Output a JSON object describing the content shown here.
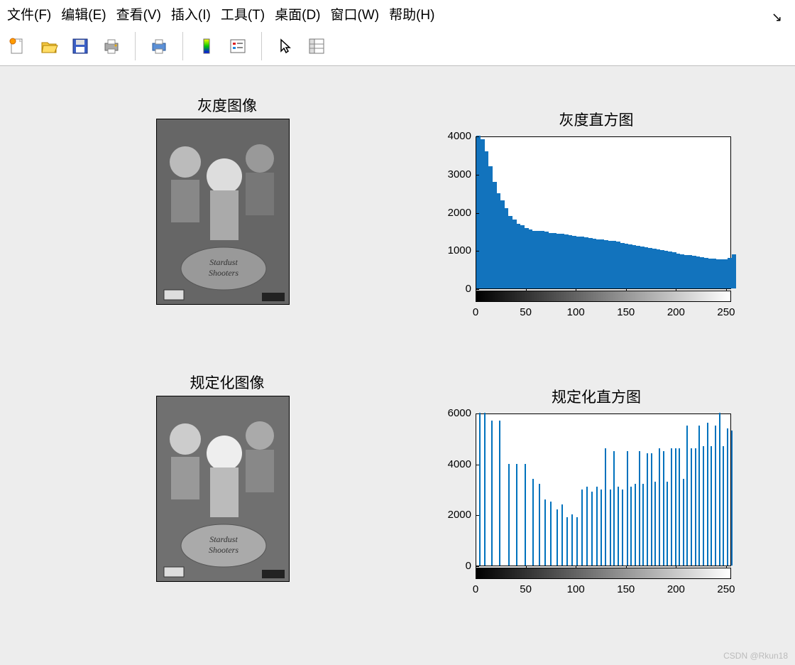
{
  "menu": {
    "items": [
      "文件(F)",
      "编辑(E)",
      "查看(V)",
      "插入(I)",
      "工具(T)",
      "桌面(D)",
      "窗口(W)",
      "帮助(H)"
    ]
  },
  "toolbar": {
    "icons": [
      "new-file-icon",
      "open-file-icon",
      "save-icon",
      "print-icon",
      "print-figure-icon",
      "colorbar-icon",
      "legend-icon",
      "pointer-icon",
      "data-cursor-icon"
    ]
  },
  "titles": {
    "sp1": "灰度图像",
    "sp2": "灰度直方图",
    "sp3": "规定化图像",
    "sp4": "规定化直方图"
  },
  "watermark": "CSDN @Rkun18",
  "chart_data": [
    {
      "type": "bar",
      "title": "灰度直方图",
      "xlabel": "",
      "ylabel": "",
      "xlim": [
        0,
        255
      ],
      "ylim": [
        0,
        4000
      ],
      "xticks": [
        0,
        50,
        100,
        150,
        200,
        250
      ],
      "yticks": [
        0,
        1000,
        2000,
        3000,
        4000
      ],
      "data_note": "256-bin histogram, peak near x=2 at ~4000 decaying to ~700 near x=220 rising to ~1000 at x=255",
      "approx_values_stride4": [
        4000,
        3900,
        3600,
        3200,
        2800,
        2500,
        2300,
        2100,
        1900,
        1800,
        1700,
        1650,
        1580,
        1550,
        1500,
        1500,
        1500,
        1480,
        1460,
        1450,
        1440,
        1430,
        1420,
        1400,
        1380,
        1360,
        1350,
        1340,
        1320,
        1300,
        1290,
        1280,
        1260,
        1250,
        1240,
        1220,
        1200,
        1180,
        1160,
        1140,
        1120,
        1100,
        1080,
        1060,
        1040,
        1020,
        1000,
        980,
        960,
        940,
        920,
        900,
        880,
        870,
        850,
        830,
        820,
        800,
        790,
        780,
        770,
        760,
        770,
        800,
        900
      ]
    },
    {
      "type": "bar",
      "title": "规定化直方图",
      "xlabel": "",
      "ylabel": "",
      "xlim": [
        0,
        255
      ],
      "ylim": [
        0,
        6000
      ],
      "xticks": [
        0,
        50,
        100,
        150,
        200,
        250
      ],
      "yticks": [
        0,
        2000,
        4000,
        6000
      ],
      "data_note": "sparse stems with irregular spacing; heights range 1800-6000; increasing density and height toward right",
      "approx_stems": [
        {
          "x": 3,
          "y": 6000
        },
        {
          "x": 8,
          "y": 6000
        },
        {
          "x": 15,
          "y": 5700
        },
        {
          "x": 23,
          "y": 5700
        },
        {
          "x": 32,
          "y": 4000
        },
        {
          "x": 40,
          "y": 4000
        },
        {
          "x": 48,
          "y": 4000
        },
        {
          "x": 56,
          "y": 3400
        },
        {
          "x": 62,
          "y": 3200
        },
        {
          "x": 68,
          "y": 2600
        },
        {
          "x": 74,
          "y": 2500
        },
        {
          "x": 80,
          "y": 2200
        },
        {
          "x": 85,
          "y": 2400
        },
        {
          "x": 90,
          "y": 1900
        },
        {
          "x": 95,
          "y": 2000
        },
        {
          "x": 100,
          "y": 1900
        },
        {
          "x": 105,
          "y": 3000
        },
        {
          "x": 110,
          "y": 3100
        },
        {
          "x": 115,
          "y": 2900
        },
        {
          "x": 120,
          "y": 3100
        },
        {
          "x": 124,
          "y": 3000
        },
        {
          "x": 128,
          "y": 4600
        },
        {
          "x": 133,
          "y": 3000
        },
        {
          "x": 137,
          "y": 4500
        },
        {
          "x": 141,
          "y": 3100
        },
        {
          "x": 145,
          "y": 3000
        },
        {
          "x": 150,
          "y": 4500
        },
        {
          "x": 154,
          "y": 3100
        },
        {
          "x": 158,
          "y": 3200
        },
        {
          "x": 162,
          "y": 4500
        },
        {
          "x": 166,
          "y": 3200
        },
        {
          "x": 170,
          "y": 4400
        },
        {
          "x": 174,
          "y": 4400
        },
        {
          "x": 178,
          "y": 3300
        },
        {
          "x": 182,
          "y": 4600
        },
        {
          "x": 186,
          "y": 4500
        },
        {
          "x": 190,
          "y": 3300
        },
        {
          "x": 194,
          "y": 4600
        },
        {
          "x": 198,
          "y": 4600
        },
        {
          "x": 202,
          "y": 4600
        },
        {
          "x": 206,
          "y": 3400
        },
        {
          "x": 210,
          "y": 5500
        },
        {
          "x": 214,
          "y": 4600
        },
        {
          "x": 218,
          "y": 4600
        },
        {
          "x": 222,
          "y": 5500
        },
        {
          "x": 226,
          "y": 4700
        },
        {
          "x": 230,
          "y": 5600
        },
        {
          "x": 234,
          "y": 4700
        },
        {
          "x": 238,
          "y": 5500
        },
        {
          "x": 242,
          "y": 6000
        },
        {
          "x": 246,
          "y": 4700
        },
        {
          "x": 250,
          "y": 5400
        },
        {
          "x": 254,
          "y": 5300
        }
      ]
    }
  ]
}
